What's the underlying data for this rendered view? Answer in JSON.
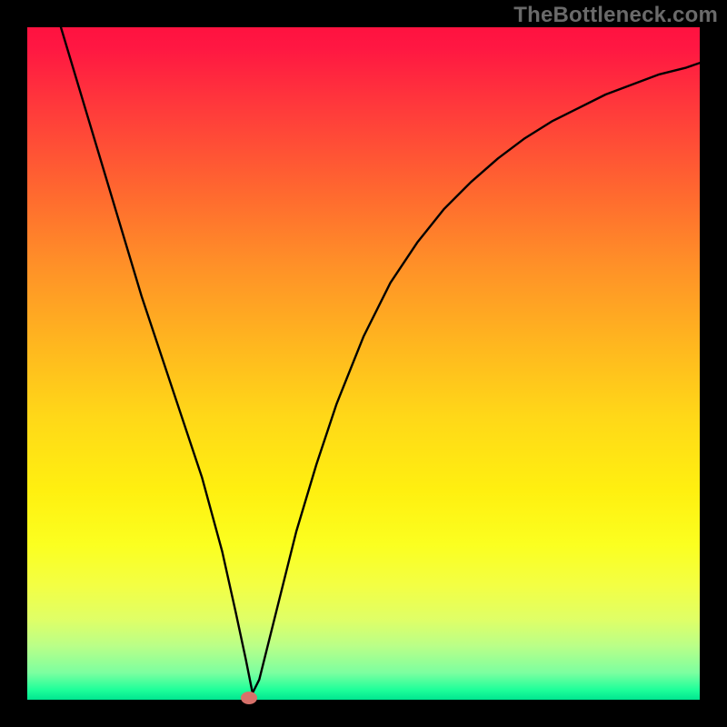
{
  "watermark": {
    "text": "TheBottleneck.com"
  },
  "chart_data": {
    "type": "line",
    "title": "",
    "xlabel": "",
    "ylabel": "",
    "xlim": [
      0,
      100
    ],
    "ylim": [
      0,
      100
    ],
    "grid": false,
    "legend": false,
    "annotations": [],
    "marker": {
      "x": 33,
      "y": 0,
      "color": "#d7716a"
    },
    "series": [
      {
        "name": "curve",
        "x": [
          5,
          8,
          11,
          14,
          17,
          20,
          23,
          26,
          29,
          31,
          32.5,
          33.5,
          34.5,
          36,
          38,
          40,
          43,
          46,
          50,
          54,
          58,
          62,
          66,
          70,
          74,
          78,
          82,
          86,
          90,
          94,
          98,
          100
        ],
        "y": [
          100,
          90,
          80,
          70,
          60,
          51,
          42,
          33,
          22,
          13,
          6,
          1,
          3,
          9,
          17,
          25,
          35,
          44,
          54,
          62,
          68,
          73,
          77,
          80.5,
          83.5,
          86,
          88,
          90,
          91.5,
          93,
          94,
          94.7
        ]
      }
    ],
    "background_gradient": {
      "top": "#ff1240",
      "mid": "#ffd818",
      "bottom": "#00e590"
    }
  }
}
